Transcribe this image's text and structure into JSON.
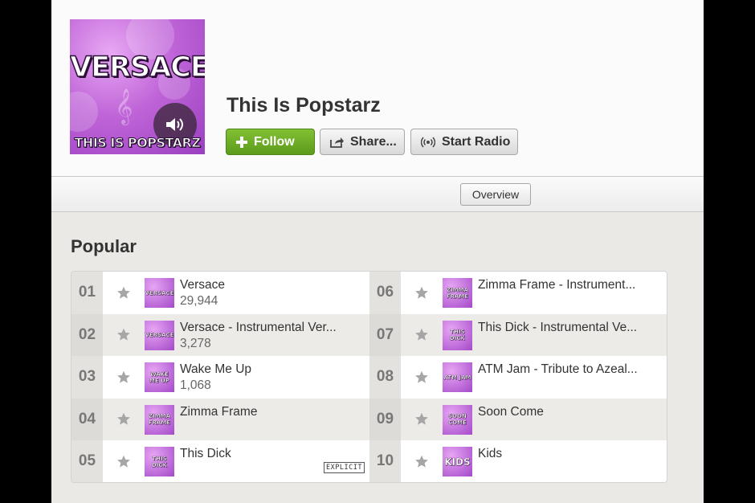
{
  "artist": {
    "name": "This Is Popstarz",
    "cover": {
      "title": "VERSACE",
      "subtitle": "THIS IS POPSTARZ"
    }
  },
  "actions": {
    "follow_label": "Follow",
    "share_label": "Share...",
    "radio_label": "Start Radio"
  },
  "tabs": {
    "overview_label": "Overview"
  },
  "popular": {
    "title": "Popular",
    "left": [
      {
        "num": "01",
        "title": "Versace",
        "plays": "29,944",
        "thumb": "VERSACE"
      },
      {
        "num": "02",
        "title": "Versace - Instrumental Ver...",
        "plays": "3,278",
        "thumb": "VERSACE"
      },
      {
        "num": "03",
        "title": "Wake Me Up",
        "plays": "1,068",
        "thumb": "WAKE ME UP"
      },
      {
        "num": "04",
        "title": "Zimma Frame",
        "plays": "",
        "thumb": "ZIMMA FRAME"
      },
      {
        "num": "05",
        "title": "This Dick",
        "plays": "",
        "thumb": "THIS DICK",
        "badge": "EXPLICIT"
      }
    ],
    "right": [
      {
        "num": "06",
        "title": "Zimma Frame - Instrument...",
        "thumb": "ZIMMA FRAME"
      },
      {
        "num": "07",
        "title": "This Dick - Instrumental Ve...",
        "thumb": "THIS DICK"
      },
      {
        "num": "08",
        "title": "ATM Jam - Tribute to Azeal...",
        "thumb": "ATM JAM"
      },
      {
        "num": "09",
        "title": "Soon Come",
        "thumb": "SOON COME"
      },
      {
        "num": "10",
        "title": "Kids",
        "thumb": "KIDS"
      }
    ]
  },
  "icons": {
    "follow": "plus-icon",
    "share": "share-icon",
    "radio": "radio-icon",
    "play": "speaker-icon",
    "star": "star-icon"
  },
  "colors": {
    "follow_green": "#6aab25",
    "cover_purple": "#b35ad6",
    "star_gray": "#9a9a9a"
  }
}
